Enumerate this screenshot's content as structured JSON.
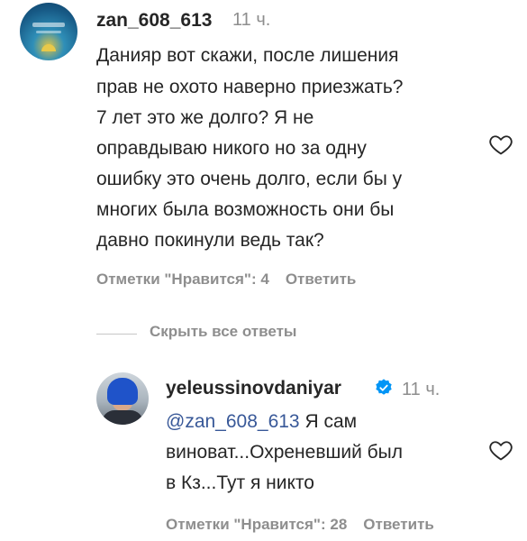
{
  "comment": {
    "username": "zan_608_613",
    "time": "11 ч.",
    "lines": [
      "Данияр вот скажи, после лишения",
      "прав не охото наверно приезжать?",
      "7 лет это же долго? Я не",
      "оправдываю никого но за одну",
      "ошибку это очень долго, если бы у",
      "многих была возможность они бы",
      "давно покинули ведь так?"
    ],
    "likes_label": "Отметки \"Нравится\": 4",
    "reply_label": "Ответить"
  },
  "hide_replies_label": "Скрыть все ответы",
  "reply": {
    "username": "yeleussinovdaniyar",
    "time": "11 ч.",
    "mention": "@zan_608_613",
    "line1_rest": " Я сам",
    "lines": [
      "виноват...Охреневший был",
      "в Кз...Тут я никто"
    ],
    "likes_label": "Отметки \"Нравится\": 28",
    "reply_label": "Ответить"
  },
  "colors": {
    "text": "#262626",
    "secondary": "#8e8e8e",
    "mention": "#385898",
    "verified": "#0095f6"
  },
  "icons": {
    "like": "heart-outline-icon",
    "verified": "verified-badge-icon"
  }
}
